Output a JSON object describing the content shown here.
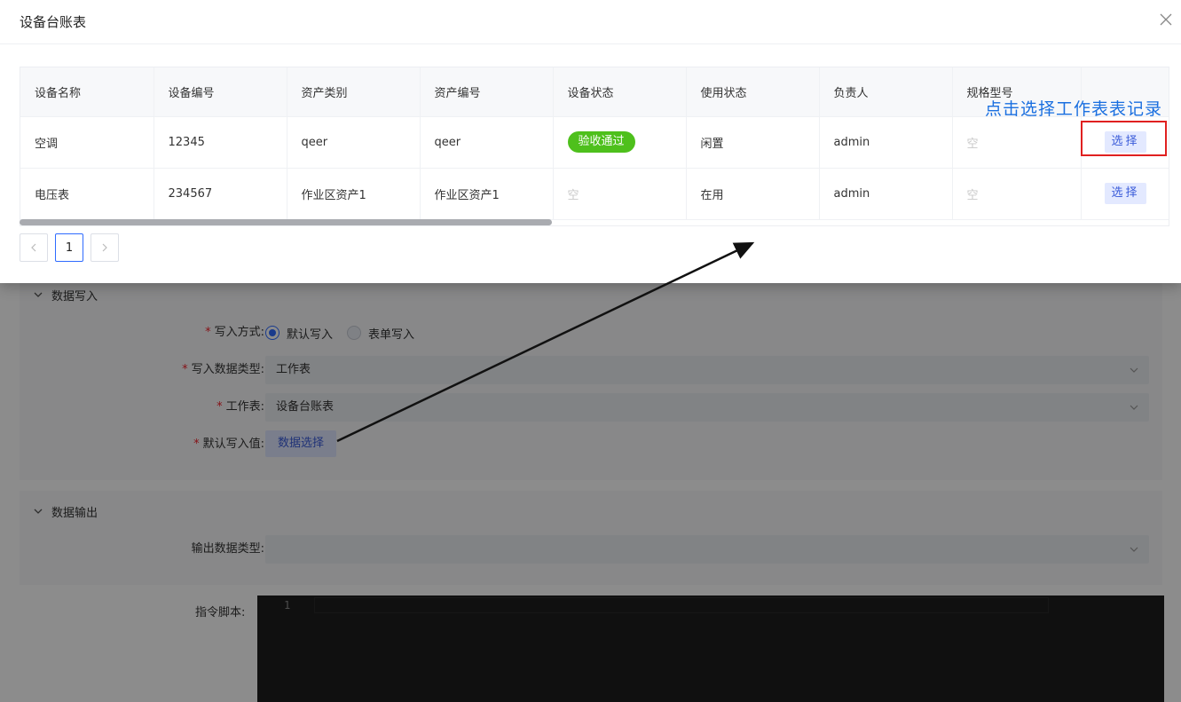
{
  "modal": {
    "title": "设备台账表",
    "columns": [
      "设备名称",
      "设备编号",
      "资产类别",
      "资产编号",
      "设备状态",
      "使用状态",
      "负责人",
      "规格型号",
      ""
    ],
    "rows": [
      {
        "name": "空调",
        "code": "12345",
        "asset_category": "qeer",
        "asset_code": "qeer",
        "device_status": "验收通过",
        "use_status": "闲置",
        "owner": "admin",
        "spec": "空",
        "action": "选择"
      },
      {
        "name": "电压表",
        "code": "234567",
        "asset_category": "作业区资产1",
        "asset_code": "作业区资产1",
        "device_status": "空",
        "use_status": "在用",
        "owner": "admin",
        "spec": "空",
        "action": "选择"
      }
    ],
    "pagination": {
      "current_page": "1",
      "prev_icon": "chevron-left-icon",
      "next_icon": "chevron-right-icon"
    }
  },
  "annotation": {
    "text": "点击选择工作表表记录",
    "color": "#1a6fe0",
    "box_color": "#e02020"
  },
  "write_section": {
    "title": "数据写入",
    "write_mode": {
      "label": "写入方式:",
      "options": [
        "默认写入",
        "表单写入"
      ],
      "selected": "默认写入"
    },
    "data_type": {
      "label": "写入数据类型:",
      "value": "工作表"
    },
    "worksheet": {
      "label": "工作表:",
      "value": "设备台账表"
    },
    "default_value": {
      "label": "默认写入值:",
      "button": "数据选择"
    }
  },
  "output_section": {
    "title": "数据输出",
    "data_type": {
      "label": "输出数据类型:",
      "value": ""
    }
  },
  "script": {
    "label": "指令脚本:",
    "line_number": "1"
  },
  "colors": {
    "primary": "#2f6bff",
    "success": "#4ec01c",
    "required": "#f5222d"
  }
}
